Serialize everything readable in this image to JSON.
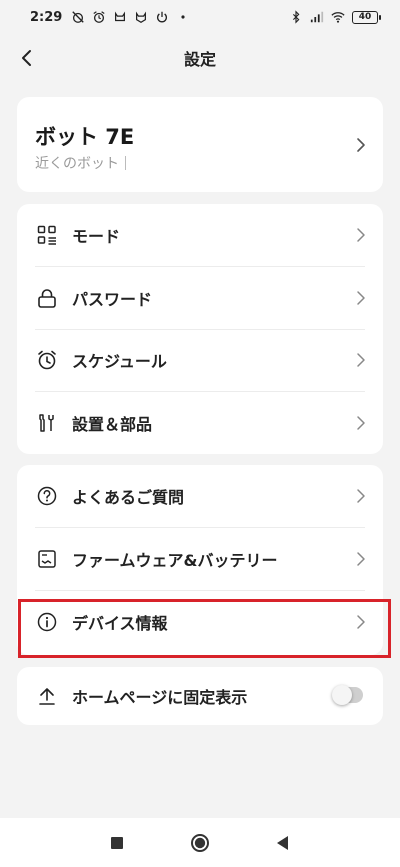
{
  "status_bar": {
    "time": "2:29",
    "battery": "40",
    "icons": [
      "muted-alarm-icon",
      "alarm-icon",
      "cat-icon",
      "cat-icon",
      "power-icon",
      "dot-icon",
      "bluetooth-icon",
      "signal-icon",
      "wifi-icon",
      "battery-icon"
    ]
  },
  "header": {
    "title": "設定",
    "back_icon": "chevron-left-icon"
  },
  "device": {
    "name": "ボット 7E",
    "subtitle": "近くのボット"
  },
  "group1": [
    {
      "label": "モード",
      "icon": "grid-list-icon"
    },
    {
      "label": "パスワード",
      "icon": "lock-icon"
    },
    {
      "label": "スケジュール",
      "icon": "alarm-clock-icon"
    },
    {
      "label": "設置＆部品",
      "icon": "tools-icon"
    }
  ],
  "group2": [
    {
      "label": "よくあるご質問",
      "icon": "question-icon"
    },
    {
      "label": "ファームウェア&バッテリー",
      "icon": "firmware-icon"
    },
    {
      "label": "デバイス情報",
      "icon": "info-icon"
    }
  ],
  "group3": {
    "label": "ホームページに固定表示",
    "icon": "pin-to-home-icon",
    "toggle_on": false
  },
  "colors": {
    "background": "#f3f3f3",
    "card": "#ffffff",
    "highlight": "#d8232a",
    "text": "#222222",
    "subtext": "#9a9a9a"
  },
  "nav": {
    "icons": [
      "recent-apps-icon",
      "home-icon",
      "back-icon"
    ]
  }
}
